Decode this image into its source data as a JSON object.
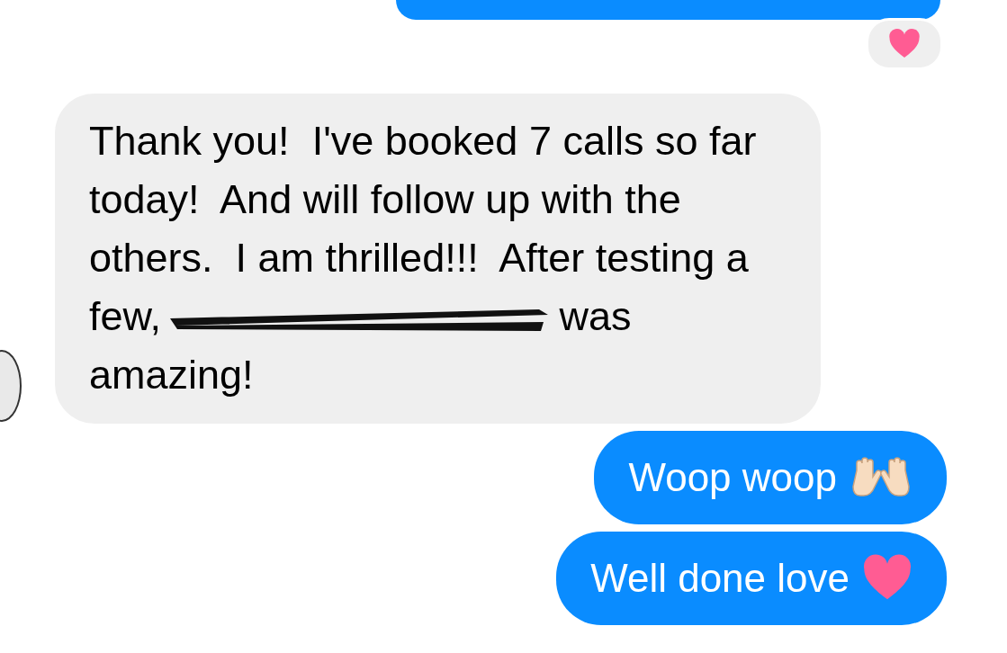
{
  "messages": [
    {
      "kind": "outgoing_cut"
    },
    {
      "kind": "reaction"
    },
    {
      "kind": "incoming_redacted",
      "text": "Thank you!  I've booked 7 calls so far today!  And will follow up with the others.  I am thrilled!!!  After testing a few,",
      "text_after": "was amazing!"
    },
    {
      "kind": "outgoing_hands",
      "text": "Woop woop"
    },
    {
      "kind": "outgoing_heart",
      "text": "Well done love"
    }
  ]
}
